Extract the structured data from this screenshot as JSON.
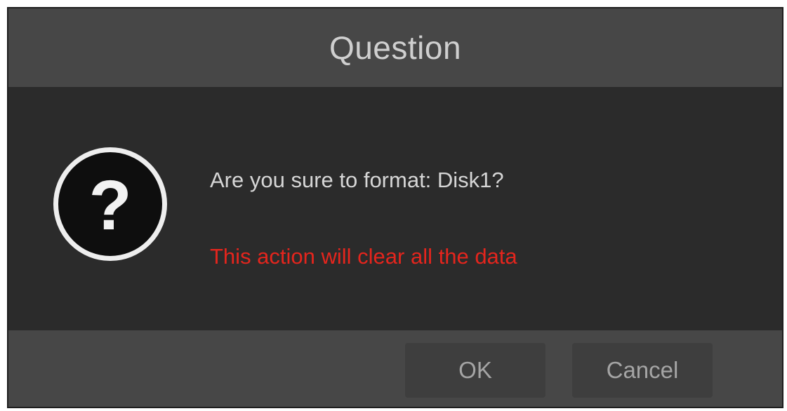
{
  "dialog": {
    "title": "Question",
    "icon": "question-icon",
    "message": "Are you sure to format: Disk1?",
    "warning": "This action will clear all the data",
    "buttons": {
      "ok_label": "OK",
      "cancel_label": "Cancel"
    }
  },
  "colors": {
    "title_bar": "#474747",
    "body": "#2b2b2b",
    "warning_text": "#e4251d",
    "button": "#3e3e3e"
  }
}
